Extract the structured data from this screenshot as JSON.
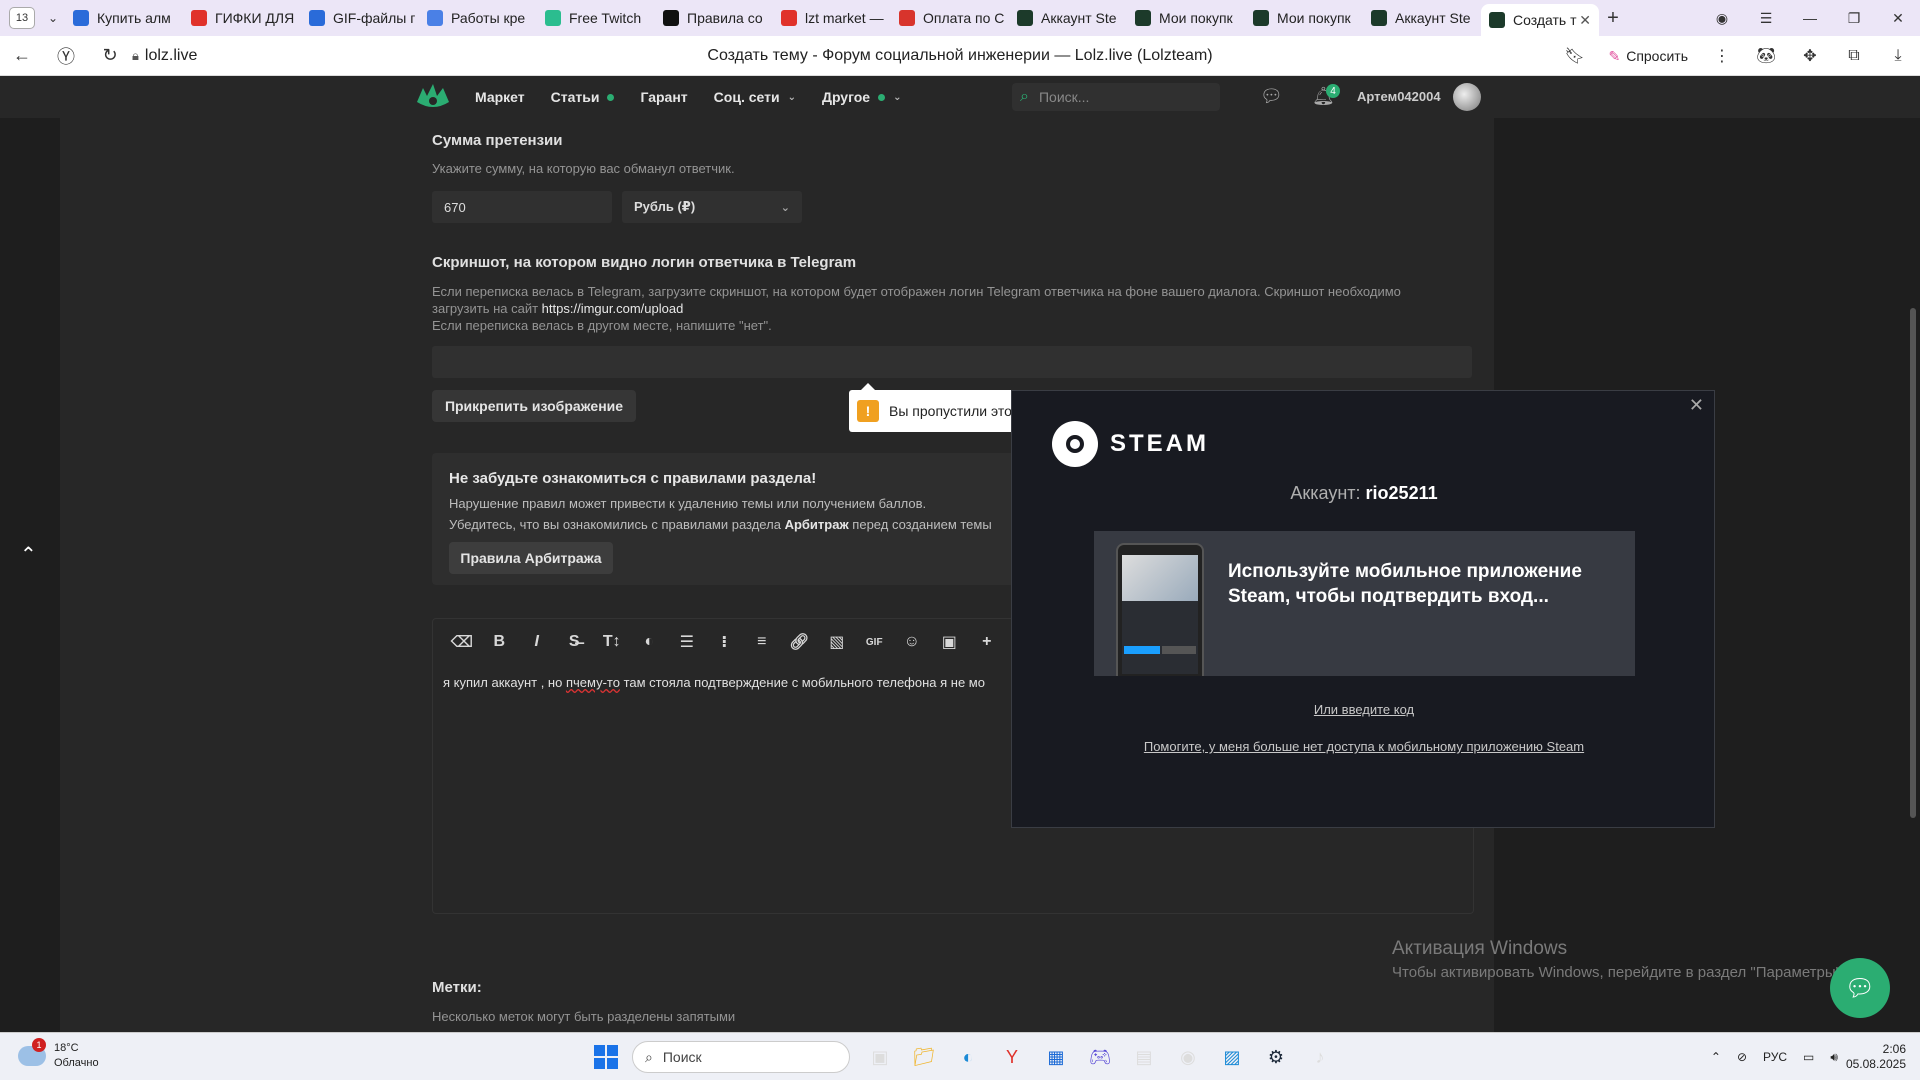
{
  "browser": {
    "tab_count": "13",
    "tabs": [
      {
        "label": "Купить алм",
        "icon": "globe-icon",
        "color": "#2a6bd9"
      },
      {
        "label": "ГИФКИ ДЛЯ",
        "icon": "yandex-icon",
        "color": "#e0312a"
      },
      {
        "label": "GIF-файлы г",
        "icon": "gif-icon",
        "color": "#2a6bd9"
      },
      {
        "label": "Работы кре",
        "icon": "doc-icon",
        "color": "#4a80e6"
      },
      {
        "label": "Free Twitch",
        "icon": "twitch-icon",
        "color": "#2bbd8f"
      },
      {
        "label": "Правила со",
        "icon": "tiktok-icon",
        "color": "#111111"
      },
      {
        "label": "lzt market —",
        "icon": "yandex-icon",
        "color": "#e0312a"
      },
      {
        "label": "Оплата по С",
        "icon": "flower-icon",
        "color": "#d8342c"
      },
      {
        "label": "Аккаунт Ste",
        "icon": "lolz-icon",
        "color": "#1c3a2a"
      },
      {
        "label": "Мои покупк",
        "icon": "lolz-icon",
        "color": "#1c3a2a"
      },
      {
        "label": "Мои покупк",
        "icon": "lolz-icon",
        "color": "#1c3a2a"
      },
      {
        "label": "Аккаунт Ste",
        "icon": "lolz-icon",
        "color": "#1c3a2a"
      },
      {
        "label": "Создать т",
        "icon": "lolz-icon",
        "color": "#1c3a2a",
        "active": true
      }
    ],
    "url": "lolz.live",
    "page_title": "Создать тему - Форум социальной инженерии — Lolz.live (Lolzteam)",
    "ask_label": "Спросить"
  },
  "site": {
    "nav": [
      {
        "label": "Маркет",
        "dot": false,
        "chevron": false
      },
      {
        "label": "Статьи",
        "dot": true,
        "chevron": false
      },
      {
        "label": "Гарант",
        "dot": false,
        "chevron": false
      },
      {
        "label": "Соц. сети",
        "dot": false,
        "chevron": true
      },
      {
        "label": "Другое",
        "dot": true,
        "chevron": true
      }
    ],
    "search_placeholder": "Поиск...",
    "notifications": "4",
    "username": "Артем042004",
    "accent": "#2bad72"
  },
  "form": {
    "claim_title": "Сумма претензии",
    "claim_hint": "Укажите сумму, на которую вас обманул ответчик.",
    "amount": "670",
    "currency": "Рубль (₽)",
    "screenshot_title": "Скриншот, на котором видно логин ответчика в Telegram",
    "screenshot_hint_1": "Если переписка велась в Telegram, загрузите скриншот, на котором будет отображен логин Telegram ответчика на фоне вашего диалога. Скриншот необходимо",
    "screenshot_hint_2": "загрузить на сайт",
    "screenshot_link": "https://imgur.com/upload",
    "screenshot_hint_3": "Если переписка велась в другом месте, напишите \"нет\".",
    "attach_button": "Прикрепить изображение",
    "tooltip": "Вы пропустили это",
    "rules_title": "Не забудьте ознакомиться с правилами раздела!",
    "rules_line1": "Нарушение правил может привести к удалению темы или получением баллов.",
    "rules_line2_a": "Убедитесь, что вы ознакомились с правилами раздела",
    "rules_line2_b": "Арбитраж",
    "rules_line2_c": "перед созданием темы",
    "rules_button": "Правила Арбитража",
    "editor_text_a": "я купил аккаунт , но ",
    "editor_text_misspelled": "пчему-то",
    "editor_text_b": "  там стояла подтверждение с мобильного телефона я не мо",
    "tags_title": "Метки:",
    "tags_hint": "Несколько меток могут быть разделены запятыми"
  },
  "toolbar_icons": [
    "eraser-icon",
    "bold-icon",
    "italic-icon",
    "strikethrough-icon",
    "text-size-icon",
    "color-icon",
    "align-icon",
    "bullet-list-icon",
    "numbered-list-icon",
    "link-icon",
    "image-icon",
    "gif-icon",
    "emoji-icon",
    "media-icon",
    "plus-icon",
    "more-icon"
  ],
  "steam": {
    "brand": "STEAM",
    "account_label": "Аккаунт:",
    "account_name": "rio25211",
    "mobile_text": "Используйте мобильное приложение Steam, чтобы подтвердить вход...",
    "enter_code": "Или введите код",
    "help_link": "Помогите, у меня больше нет доступа к мобильному приложению Steam"
  },
  "activation": {
    "title": "Активация Windows",
    "subtitle": "Чтобы активировать Windows, перейдите в раздел \"Параметры\"."
  },
  "taskbar": {
    "weather_temp": "18°C",
    "weather_desc": "Облачно",
    "weather_badge": "1",
    "search_placeholder": "Поиск",
    "lang": "РУС",
    "time": "2:06",
    "date": "05.08.2025"
  }
}
